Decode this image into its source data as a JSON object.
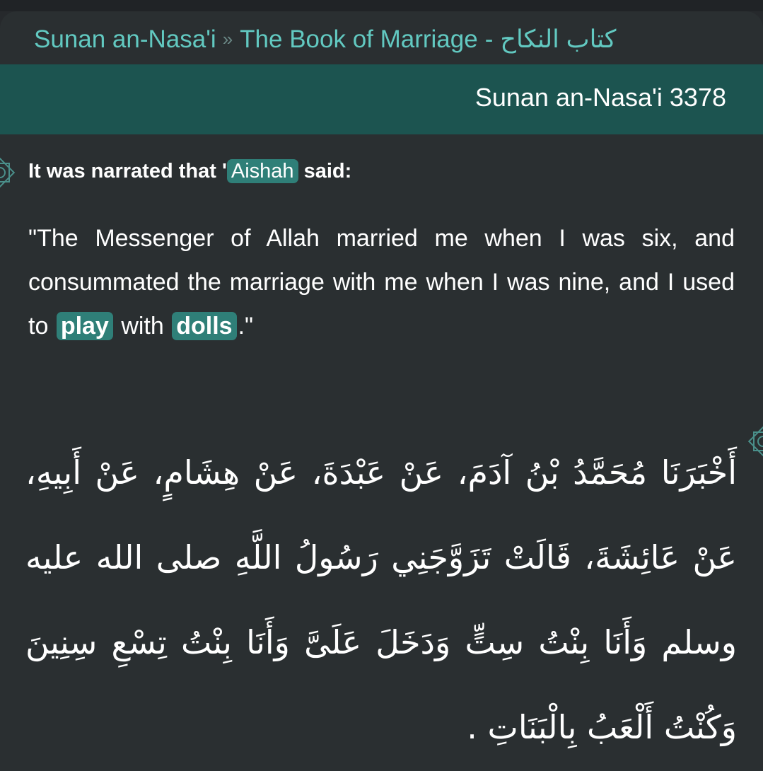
{
  "breadcrumb": {
    "collection": "Sunan an-Nasa'i",
    "separator": "»",
    "book": "The Book of Marriage",
    "dash": "-",
    "book_arabic": "كتاب النكاح"
  },
  "reference": "Sunan an-Nasa'i 3378",
  "narrator": {
    "prefix": "It was narrated that '",
    "name": "Aishah",
    "suffix": " said:"
  },
  "english": {
    "part1": "\"The Messenger of Allah married me when I was six, and consummated the marriage with me when I was nine, and I used to",
    "link1": "play",
    "part2": "with",
    "link2": "dolls",
    "part3": ".\""
  },
  "arabic_text": "أَخْبَرَنَا مُحَمَّدُ بْنُ آدَمَ، عَنْ عَبْدَةَ، عَنْ هِشَامٍ، عَنْ أَبِيهِ، عَنْ عَائِشَةَ، قَالَتْ تَزَوَّجَنِي رَسُولُ اللَّهِ صلى الله عليه وسلم وَأَنَا بِنْتُ سِتٍّ وَدَخَلَ عَلَىَّ وَأَنَا بِنْتُ تِسْعِ سِنِينَ وَكُنْتُ أَلْعَبُ بِالْبَنَاتِ ‏.‏",
  "colors": {
    "accent": "#62c9c1",
    "reference_bar": "#1c5450",
    "tag_background": "#2f7f78",
    "background": "#2a2f31"
  },
  "icons": {
    "ornament": "ornament-icon"
  }
}
